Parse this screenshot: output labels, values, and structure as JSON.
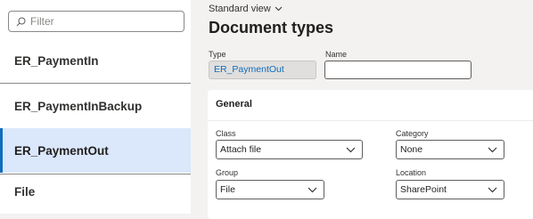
{
  "filter": {
    "placeholder": "Filter"
  },
  "list": {
    "items": [
      {
        "label": "ER_PaymentIn"
      },
      {
        "label": "ER_PaymentInBackup"
      },
      {
        "label": "ER_PaymentOut"
      },
      {
        "label": "File"
      }
    ],
    "selected_index": 2
  },
  "header": {
    "view_label": "Standard view",
    "title": "Document types"
  },
  "form": {
    "type_label": "Type",
    "type_value": "ER_PaymentOut",
    "name_label": "Name",
    "name_value": ""
  },
  "general": {
    "title": "General",
    "class_label": "Class",
    "class_value": "Attach file",
    "category_label": "Category",
    "category_value": "None",
    "group_label": "Group",
    "group_value": "File",
    "location_label": "Location",
    "location_value": "SharePoint"
  },
  "colors": {
    "accent": "#0f6cbd",
    "selected_background": "#dbe7fb",
    "page_background": "#f3f2f1"
  },
  "icons": {
    "filter": "search-icon",
    "dropdown": "chevron-down-icon"
  }
}
